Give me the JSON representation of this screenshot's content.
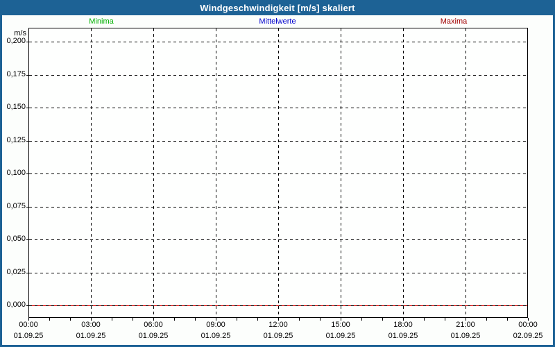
{
  "title_bar": {
    "title": "Windgeschwindigkeit [m/s] skaliert"
  },
  "legend": {
    "items": [
      {
        "label": "Minima",
        "color": "#00B000"
      },
      {
        "label": "Mittelwerte",
        "color": "#0000CC"
      },
      {
        "label": "Maxima",
        "color": "#A00000"
      }
    ]
  },
  "y_axis": {
    "unit": "m/s",
    "labels": [
      "0,200",
      "0,175",
      "0,150",
      "0,125",
      "0,100",
      "0,075",
      "0,050",
      "0,025",
      "0,000"
    ]
  },
  "x_axis": {
    "ticks": [
      {
        "time": "00:00",
        "date": "01.09.25"
      },
      {
        "time": "03:00",
        "date": "01.09.25"
      },
      {
        "time": "06:00",
        "date": "01.09.25"
      },
      {
        "time": "09:00",
        "date": "01.09.25"
      },
      {
        "time": "12:00",
        "date": "01.09.25"
      },
      {
        "time": "15:00",
        "date": "01.09.25"
      },
      {
        "time": "18:00",
        "date": "01.09.25"
      },
      {
        "time": "21:00",
        "date": "01.09.25"
      },
      {
        "time": "00:00",
        "date": "02.09.25"
      }
    ]
  },
  "colors": {
    "titlebar": "#1D6295",
    "frame": "#1D6295",
    "grid": "#000000",
    "zero_line": "#E00000",
    "plot_background": "#FEFFFE",
    "page_background": "#FCFEFC"
  },
  "chart_data": {
    "type": "line",
    "title": "Windgeschwindigkeit [m/s] skaliert",
    "ylabel": "m/s",
    "ylim": [
      0.0,
      0.2
    ],
    "ytick_step": 0.025,
    "grid": true,
    "legend_position": "top",
    "x": [
      "00:00 01.09.25",
      "03:00 01.09.25",
      "06:00 01.09.25",
      "09:00 01.09.25",
      "12:00 01.09.25",
      "15:00 01.09.25",
      "18:00 01.09.25",
      "21:00 01.09.25",
      "00:00 02.09.25"
    ],
    "series": [
      {
        "name": "Minima",
        "color": "#00B000",
        "values": [
          0.0,
          0.0,
          0.0,
          0.0,
          0.0,
          0.0,
          0.0,
          0.0,
          0.0
        ]
      },
      {
        "name": "Mittelwerte",
        "color": "#0000CC",
        "values": [
          0.0,
          0.0,
          0.0,
          0.0,
          0.0,
          0.0,
          0.0,
          0.0,
          0.0
        ]
      },
      {
        "name": "Maxima",
        "color": "#E00000",
        "values": [
          0.0,
          0.0,
          0.0,
          0.0,
          0.0,
          0.0,
          0.0,
          0.0,
          0.0
        ]
      }
    ]
  }
}
